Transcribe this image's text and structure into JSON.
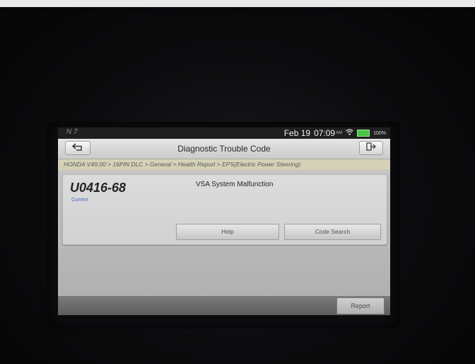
{
  "status_bar": {
    "left_icons": "N 7",
    "date": "Feb 19",
    "time": "07:09",
    "ampm": "AM",
    "battery": "100%"
  },
  "title_bar": {
    "title": "Diagnostic Trouble Code"
  },
  "breadcrumb": "HONDA V49.00 > 16PIN DLC > General > Health Report > EPS(Electric Power Steering)",
  "dtc": {
    "code": "U0416-68",
    "status": "Current",
    "description": "VSA System Malfunction"
  },
  "buttons": {
    "help": "Help",
    "code_search": "Code Search",
    "report": "Report"
  },
  "colors": {
    "breadcrumb_bg": "#d8d5b8",
    "status_text": "#3d66c6",
    "battery": "#3fc23c"
  }
}
